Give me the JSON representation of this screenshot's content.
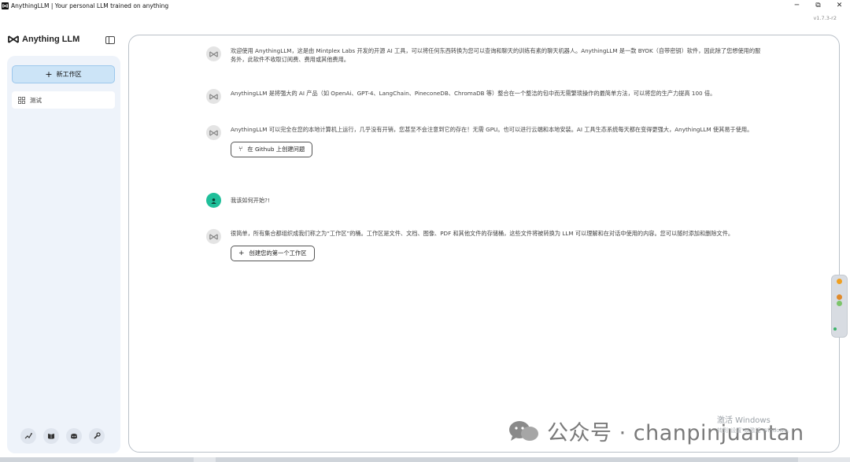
{
  "window": {
    "title": "AnythingLLM | Your personal LLM trained on anything",
    "minimize": "─",
    "restore": "⧉",
    "close": "✕",
    "version": "v1.7.3-r2"
  },
  "brand": {
    "name": "Anything LLM"
  },
  "sidebar": {
    "new_workspace_label": "新工作区",
    "workspaces": [
      {
        "name": "测试"
      }
    ],
    "footer_icons": [
      "community-hub-icon",
      "docs-book-icon",
      "discord-icon",
      "settings-wrench-icon"
    ]
  },
  "messages": [
    {
      "role": "assistant",
      "text": "欢迎使用 AnythingLLM，这是由 Mintplex Labs 开发的开源 AI 工具，可以将任何东西转换为您可以查询和聊天的训练有素的聊天机器人。AnythingLLM 是一款 BYOK（自带密钥）软件，因此除了您想使用的服务外，此软件不收取订阅费、费用或其他费用。"
    },
    {
      "role": "assistant",
      "text": "AnythingLLM 是将强大的 AI 产品（如 OpenAi、GPT-4、LangChain、PineconeDB、ChromaDB 等）整合在一个整洁的包中而无需繁琐操作的最简单方法，可以将您的生产力提高 100 倍。"
    },
    {
      "role": "assistant",
      "text": "AnythingLLM 可以完全在您的本地计算机上运行，几乎没有开销，您甚至不会注意到它的存在！无需 GPU。也可以进行云端和本地安装。AI 工具生态系统每天都在变得更强大，AnythingLLM 使其易于使用。",
      "action": "在 Github 上创建问题"
    },
    {
      "role": "user",
      "text": "我该如何开始?!"
    },
    {
      "role": "assistant",
      "text": "很简单，所有集合都组织成我们称之为“工作区”的桶。工作区是文件、文档、图像、PDF 和其他文件的存储桶，这些文件将被转换为 LLM 可以理解和在对话中使用的内容。您可以随时添加和删除文件。",
      "action": "创建您的第一个工作区"
    }
  ],
  "watermarks": {
    "activate_line1": "激活 Windows",
    "activate_line2": "转到\"设置\"以激活 Windows。",
    "wechat": "公众号 · chanpinjuantan"
  },
  "colors": {
    "accent": "#cce4f7",
    "sidebar_bg": "#eef3fa",
    "user_avatar": "#1fbf9a"
  }
}
